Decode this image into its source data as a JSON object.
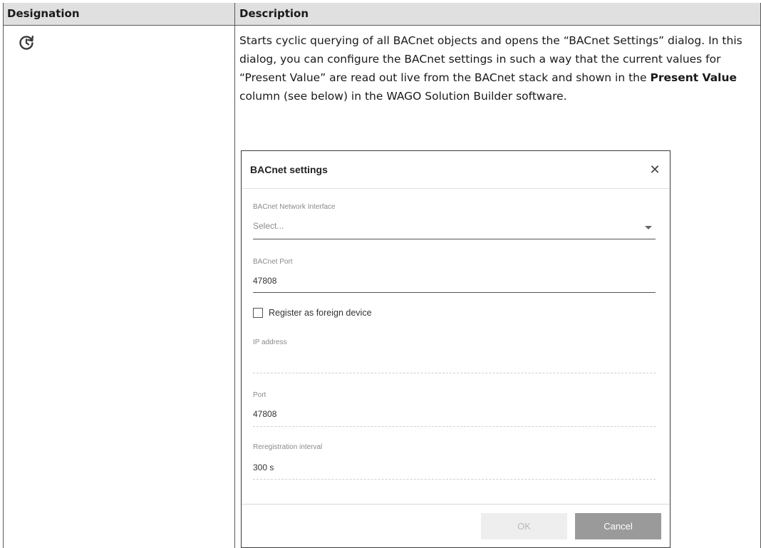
{
  "table": {
    "headers": [
      "Designation",
      "Description"
    ],
    "row": {
      "icon": "cyclic-refresh-icon",
      "description": {
        "text_before_bold": "Starts cyclic querying of all BACnet objects and opens the “BACnet Settings” dialog. In this dialog, you can configure the BACnet settings in such a way that the current values for “Present Value” are read out live from the BACnet stack and shown in the ",
        "bold": "Present Value",
        "text_after_bold": " column (see below) in the WAGO Solution Builder software."
      }
    }
  },
  "dialog": {
    "title": "BACnet settings",
    "close_icon": "close-icon",
    "network_interface": {
      "label": "BACnet Network Interface",
      "placeholder": "Select..."
    },
    "port": {
      "label": "BACnet Port",
      "value": "47808"
    },
    "foreign_device": {
      "label": "Register as foreign device",
      "checked": false
    },
    "ip_address": {
      "label": "IP address",
      "value": ""
    },
    "fd_port": {
      "label": "Port",
      "value": "47808"
    },
    "reregistration": {
      "label": "Reregistration interval",
      "value": "300 s"
    },
    "ok_label": "OK",
    "cancel_label": "Cancel"
  }
}
